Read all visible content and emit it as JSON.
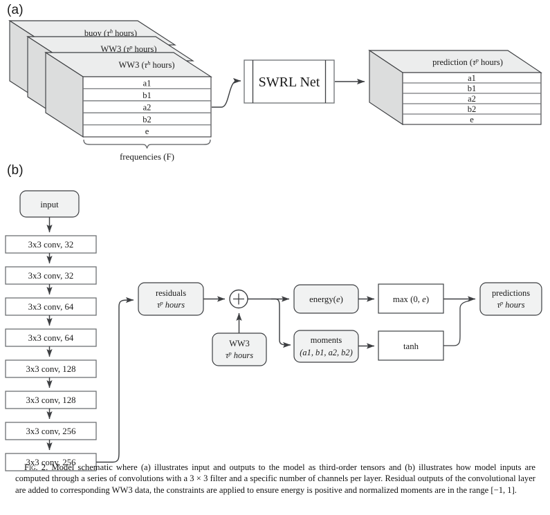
{
  "figure": {
    "panel_a_label": "(a)",
    "panel_b_label": "(b)",
    "caption_lead": "Fig. 2.",
    "caption_text": "Model schematic where (a) illustrates input and outputs to the model as third-order tensors and (b) illustrates how model inputs are computed through a series of convolutions with a 3 × 3 filter and a specific number of channels per layer. Residual outputs of the convolutional layer are added to corresponding WW3 data, the constraints are applied to ensure energy is positive and normalized moments are in the range [−1, 1]."
  },
  "panel_a": {
    "input_tensor": {
      "slab_labels": [
        {
          "name": "buoy",
          "tau": "h",
          "suffix": " hours"
        },
        {
          "name": "WW3",
          "tau": "p",
          "suffix": " hours"
        },
        {
          "name": "WW3",
          "tau": "h",
          "suffix": " hours"
        }
      ],
      "rows": [
        "a1",
        "b1",
        "a2",
        "b2",
        "e"
      ],
      "axis_brace_label": "frequencies (F)"
    },
    "model_box": {
      "label": "SWRL Net"
    },
    "output_tensor": {
      "slab_label": {
        "name": "prediction",
        "tau": "p",
        "suffix": " hours"
      },
      "rows": [
        "a1",
        "b1",
        "a2",
        "b2",
        "e"
      ]
    }
  },
  "panel_b": {
    "input_node": {
      "label": "input"
    },
    "conv_layers": [
      {
        "label": "3x3 conv, 32"
      },
      {
        "label": "3x3 conv, 32"
      },
      {
        "label": "3x3 conv, 64"
      },
      {
        "label": "3x3 conv, 64"
      },
      {
        "label": "3x3 conv, 128"
      },
      {
        "label": "3x3 conv, 128"
      },
      {
        "label": "3x3 conv, 256"
      },
      {
        "label": "3x3 conv, 256"
      }
    ],
    "residuals_node": {
      "line1": "residuals",
      "tau": "p",
      "line2_suffix": " hours"
    },
    "add_operator": {
      "symbol": "+"
    },
    "ww3_node": {
      "line1": "WW3",
      "tau": "p",
      "line2_suffix": " hours"
    },
    "energy_node": {
      "label_prefix": "energy(",
      "label_var": "e",
      "label_suffix": ")"
    },
    "moments_node": {
      "line1": "moments",
      "line2": "(a1, b1, a2, b2)"
    },
    "max_node": {
      "label_prefix": "max (0, ",
      "label_var": "e",
      "label_suffix": ")"
    },
    "tanh_node": {
      "label": "tanh"
    },
    "predictions_node": {
      "line1": "predictions",
      "tau": "p",
      "line2_suffix": " hours"
    }
  },
  "colors": {
    "slab_top": "#eceded",
    "slab_side": "#dcdddd",
    "box_fill": "#f1f2f2",
    "stroke": "#3d3f42"
  }
}
